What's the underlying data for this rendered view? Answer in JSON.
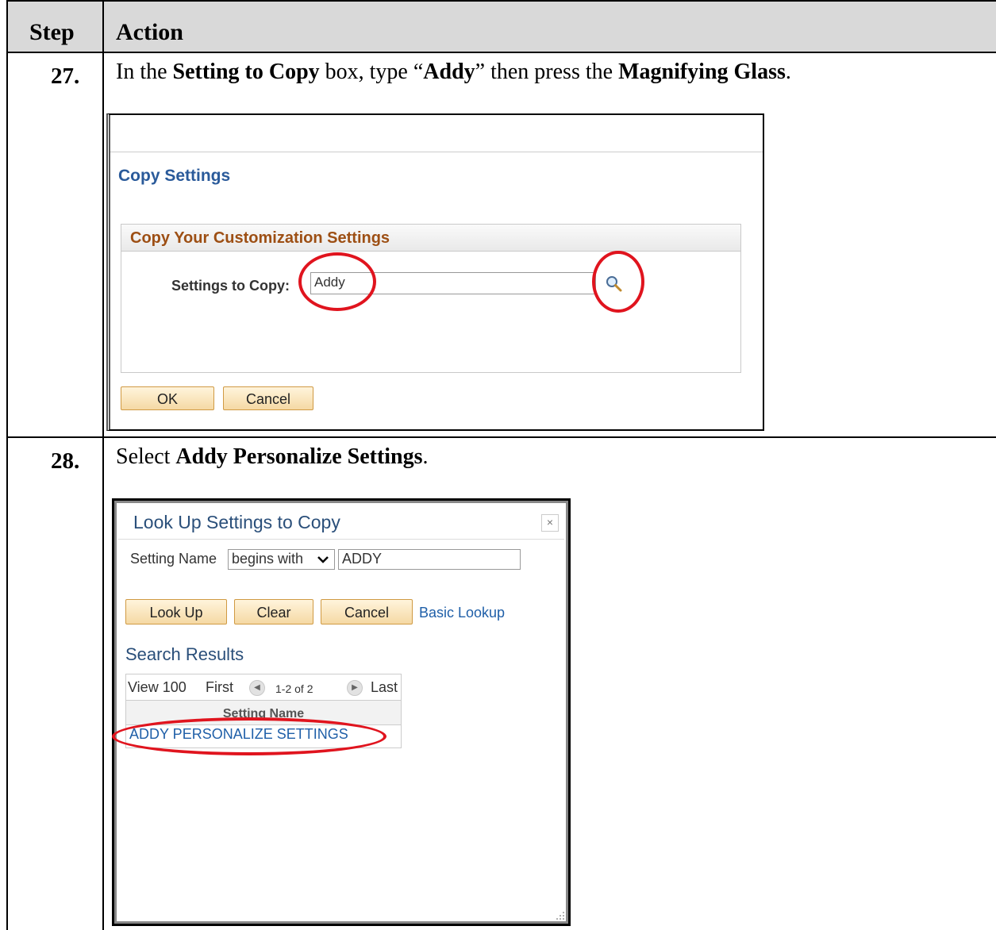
{
  "table": {
    "header": {
      "step": "Step",
      "action": "Action"
    }
  },
  "steps": [
    {
      "number": "27.",
      "instruction": {
        "p1": "In the ",
        "b1": "Setting to Copy",
        "p2": " box, type “",
        "b2": "Addy",
        "p3": "” then press the ",
        "b3": "Magnifying Glass",
        "p4": "."
      },
      "screenshot": {
        "title": "Copy Settings",
        "panel_title": "Copy Your Customization Settings",
        "field_label": "Settings to Copy:",
        "field_value": "Addy",
        "ok_label": "OK",
        "cancel_label": "Cancel",
        "icon": "magnifying-glass-icon"
      }
    },
    {
      "number": "28.",
      "instruction": {
        "p1": "Select ",
        "b1": "Addy Personalize Settings",
        "p2": "."
      },
      "screenshot": {
        "title": "Look Up Settings to Copy",
        "close": "×",
        "filter_label": "Setting Name",
        "filter_operator": "begins with",
        "filter_value": "ADDY",
        "lookup_label": "Look Up",
        "clear_label": "Clear",
        "cancel_label": "Cancel",
        "basic_lookup_label": "Basic Lookup",
        "results_title": "Search Results",
        "view_all": "View 100",
        "first": "First",
        "range": "1-2 of 2",
        "last": "Last",
        "column_header": "Setting Name",
        "result_row": "ADDY PERSONALIZE SETTINGS"
      }
    }
  ],
  "highlight_color": "#e0141e"
}
